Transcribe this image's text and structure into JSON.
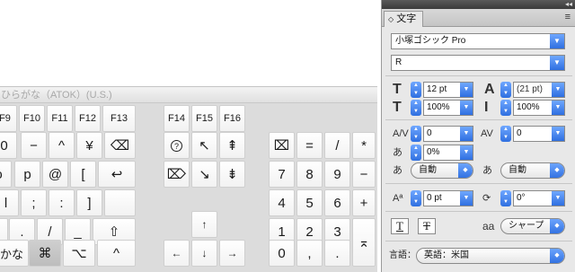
{
  "keyboard": {
    "title": "ひらがな（ATOK）(U.S.)",
    "fn_keys": [
      "F9",
      "F10",
      "F11",
      "F12",
      "F13",
      "F14",
      "F15",
      "F16"
    ],
    "row1": [
      "0",
      "−",
      "^",
      "¥"
    ],
    "row2": [
      "o",
      "p",
      "@",
      "["
    ],
    "row3": [
      "l",
      ";",
      ":",
      "]"
    ],
    "row4": [
      ",",
      ".",
      "/",
      "_"
    ],
    "row5_left": [
      "かな",
      "⌘",
      "⌥",
      "^"
    ],
    "delete_icon": "⌫",
    "return_icon": "↩",
    "shift_icon": "⇧",
    "nav_row1": [
      "?",
      "↖",
      "⇞"
    ],
    "nav_row2": [
      "⌦",
      "↘",
      "⇟"
    ],
    "arrows": {
      "up": "↑",
      "left": "←",
      "down": "↓",
      "right": "→"
    },
    "keypad": {
      "row1": [
        "⌧",
        "=",
        "/",
        "*"
      ],
      "row2": [
        "7",
        "8",
        "9",
        "−"
      ],
      "row3": [
        "4",
        "5",
        "6",
        "+"
      ],
      "row4": [
        "1",
        "2",
        "3"
      ],
      "row5": [
        "0",
        ",",
        "."
      ],
      "enter": "⌅"
    }
  },
  "panel": {
    "tab_label": "文字",
    "tab_chevron": "◇",
    "menu_icon": "≡",
    "collapse_icon": "◂◂",
    "font_family": "小塚ゴシック Pro",
    "font_style": "R",
    "font_size": "12 pt",
    "leading": "(21 pt)",
    "vertical_scale": "100%",
    "horizontal_scale": "100%",
    "kerning": "0",
    "tracking": "0",
    "tsume": "0%",
    "aki_left": "自動",
    "aki_right": "自動",
    "baseline_shift": "0 pt",
    "rotation": "0°",
    "antialias": "シャープ",
    "language_label": "言語：",
    "language": "英語：米国",
    "antialias_icon_text": "aa"
  }
}
